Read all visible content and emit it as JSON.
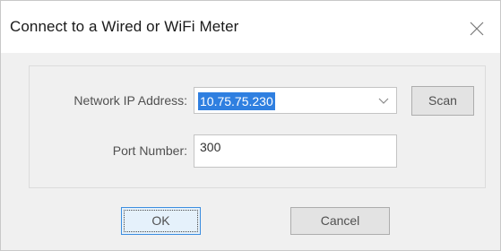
{
  "window": {
    "title": "Connect to a Wired or WiFi Meter",
    "close_icon": "close-icon"
  },
  "form": {
    "ip_label": "Network IP Address:",
    "ip_value": "10.75.75.230",
    "port_label": "Port Number:",
    "port_value": "300"
  },
  "buttons": {
    "scan": "Scan",
    "ok": "OK",
    "cancel": "Cancel"
  },
  "colors": {
    "selection": "#2f7fe0",
    "default_button_border": "#3c8ee0"
  }
}
